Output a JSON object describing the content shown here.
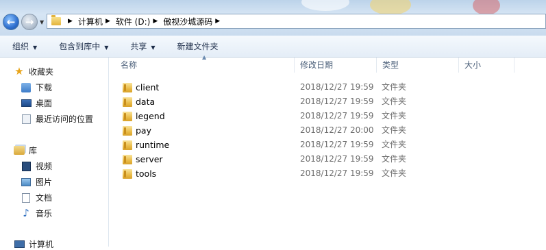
{
  "address_bar": {
    "breadcrumbs": [
      "计算机",
      "软件 (D:)",
      "傲视沙城源码"
    ]
  },
  "toolbar": {
    "items": [
      {
        "label": "组织",
        "has_dropdown": true
      },
      {
        "label": "包含到库中",
        "has_dropdown": true
      },
      {
        "label": "共享",
        "has_dropdown": true
      },
      {
        "label": "新建文件夹",
        "has_dropdown": false
      }
    ]
  },
  "nav": {
    "favorites": {
      "label": "收藏夹",
      "icon": "star-icon"
    },
    "favorite_items": [
      {
        "label": "下载",
        "icon": "download-folder-icon"
      },
      {
        "label": "桌面",
        "icon": "desktop-icon"
      },
      {
        "label": "最近访问的位置",
        "icon": "recent-places-icon"
      }
    ],
    "libraries": {
      "label": "库",
      "icon": "library-icon"
    },
    "library_items": [
      {
        "label": "视频",
        "icon": "video-icon"
      },
      {
        "label": "图片",
        "icon": "picture-icon"
      },
      {
        "label": "文档",
        "icon": "document-icon"
      },
      {
        "label": "音乐",
        "icon": "music-icon"
      }
    ],
    "computer": {
      "label": "计算机",
      "icon": "computer-icon"
    }
  },
  "file_list": {
    "columns": [
      "名称",
      "修改日期",
      "类型",
      "大小"
    ],
    "sorted_by": "名称",
    "rows": [
      {
        "name": "client",
        "modified": "2018/12/27 19:59",
        "type": "文件夹"
      },
      {
        "name": "data",
        "modified": "2018/12/27 19:59",
        "type": "文件夹"
      },
      {
        "name": "legend",
        "modified": "2018/12/27 19:59",
        "type": "文件夹"
      },
      {
        "name": "pay",
        "modified": "2018/12/27 20:00",
        "type": "文件夹"
      },
      {
        "name": "runtime",
        "modified": "2018/12/27 19:59",
        "type": "文件夹"
      },
      {
        "name": "server",
        "modified": "2018/12/27 19:59",
        "type": "文件夹"
      },
      {
        "name": "tools",
        "modified": "2018/12/27 19:59",
        "type": "文件夹"
      }
    ]
  }
}
